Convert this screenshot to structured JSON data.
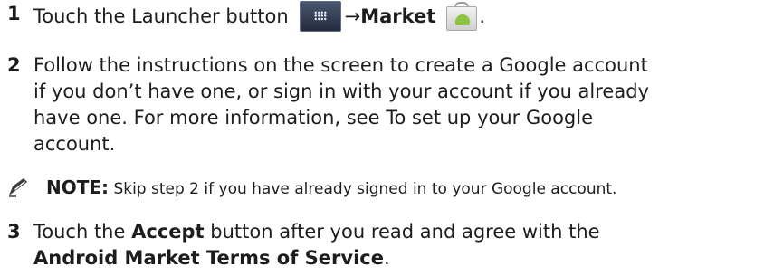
{
  "steps": [
    {
      "number": "1",
      "text_before": "Touch the Launcher button",
      "arrow": "→",
      "bold": "Market",
      "period": ".",
      "icons": [
        "launcher-grid-icon",
        "android-market-icon"
      ]
    },
    {
      "number": "2",
      "lines": [
        "Follow the instructions on the screen to create a Google account",
        "if you don’t have one, or sign in with your account if you already",
        "have one. For more information, see To set up your Google",
        "account."
      ]
    },
    {
      "number": "3",
      "line1_before": "Touch the",
      "line1_bold": "Accept",
      "line1_after": "button after you read and agree with the",
      "line2_bold": "Android Market Terms of Service",
      "line2_after": "."
    }
  ],
  "note": {
    "icon": "pencil-note-icon",
    "label": "NOTE:",
    "text": "Skip step 2 if you have already signed in to your Google account."
  },
  "colors": {
    "text": "#1d1d1d",
    "launcher_button": "#2f3850",
    "android_green": "#8cc341"
  }
}
